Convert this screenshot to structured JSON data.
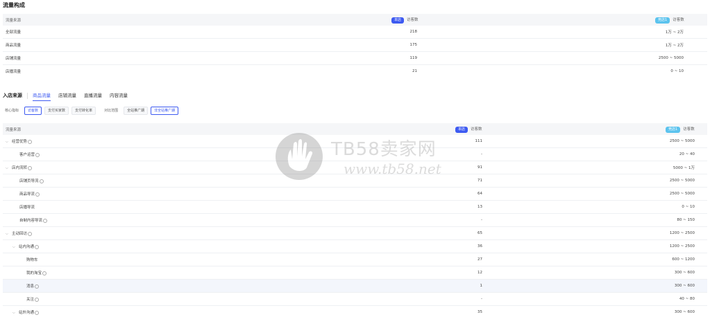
{
  "traffic": {
    "title": "流量构成",
    "headers": {
      "source": "流量来源",
      "ours_badge": "本店",
      "ours_col": "访客数",
      "comp_badge": "竞店1",
      "comp_col": "访客数"
    },
    "rows": [
      {
        "name": "全部流量",
        "ours": "218",
        "comp": "1万 ~ 2万"
      },
      {
        "name": "商品流量",
        "ours": "175",
        "comp": "1万 ~ 2万"
      },
      {
        "name": "店铺流量",
        "ours": "119",
        "comp": "2500 ~ 5000"
      },
      {
        "name": "店播流量",
        "ours": "21",
        "comp": "0 ~ 10"
      }
    ]
  },
  "entry": {
    "label": "入店来源",
    "tabs": [
      "商品流量",
      "店铺流量",
      "直播流量",
      "内容流量"
    ],
    "filters": {
      "metric_label": "核心指标",
      "metrics": [
        "访客数",
        "支付买家数",
        "支付转化率"
      ],
      "compare_label": "对比范围",
      "ranges": [
        "全站推广期",
        "非全站推广期"
      ]
    },
    "headers": {
      "source": "流量来源",
      "ours_badge": "本店",
      "ours_col": "访客数",
      "comp_badge": "竞店1",
      "comp_col": "访客数"
    },
    "rows": [
      {
        "name": "经营优势",
        "ours": "111",
        "comp": "2500 ~ 5000"
      },
      {
        "name": "客户运营",
        "ours": "-",
        "comp": "20 ~ 40"
      },
      {
        "name": "店内流转",
        "ours": "91",
        "comp": "5000 ~ 1万"
      },
      {
        "name": "店铺页导流",
        "ours": "71",
        "comp": "2500 ~ 5000"
      },
      {
        "name": "商品导流",
        "ours": "64",
        "comp": "2500 ~ 5000"
      },
      {
        "name": "店播导流",
        "ours": "13",
        "comp": "0 ~ 10"
      },
      {
        "name": "自制内容导流",
        "ours": "-",
        "comp": "80 ~ 150"
      },
      {
        "name": "主动回访",
        "ours": "65",
        "comp": "1200 ~ 2500"
      },
      {
        "name": "站内沟通",
        "ours": "36",
        "comp": "1200 ~ 2500"
      },
      {
        "name": "购物车",
        "ours": "27",
        "comp": "600 ~ 1200"
      },
      {
        "name": "我的淘宝",
        "ours": "12",
        "comp": "300 ~ 600"
      },
      {
        "name": "消息",
        "ours": "1",
        "comp": "300 ~ 600"
      },
      {
        "name": "关注",
        "ours": "-",
        "comp": "40 ~ 80"
      },
      {
        "name": "站外沟通",
        "ours": "35",
        "comp": "300 ~ 600"
      }
    ]
  },
  "watermark": {
    "brand": "TB58卖家网",
    "url": "www.tb58.net"
  }
}
